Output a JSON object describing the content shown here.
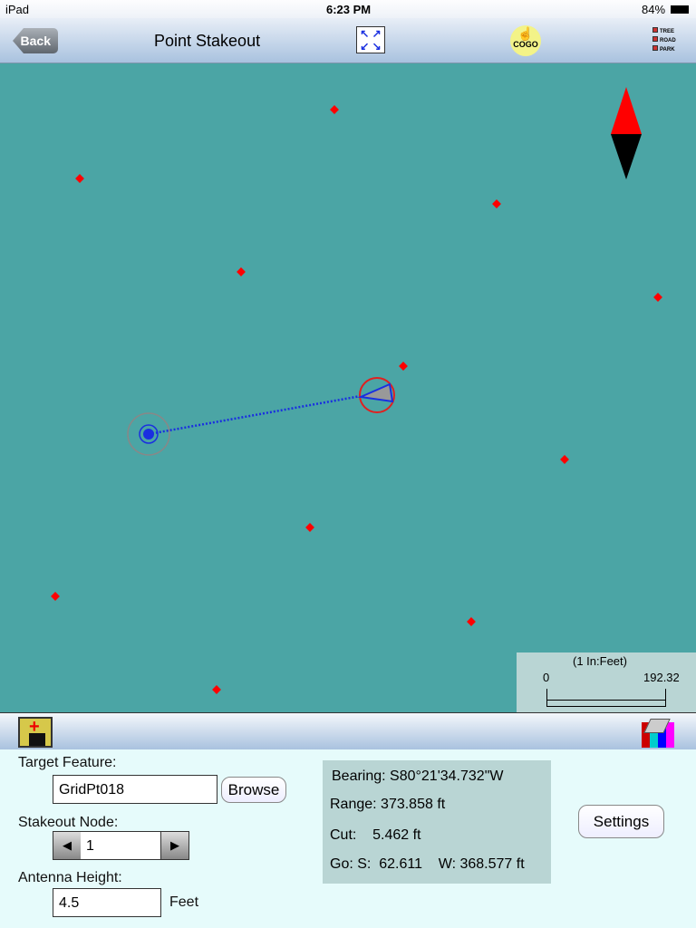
{
  "status": {
    "device": "iPad",
    "time": "6:23 PM",
    "battery": "84%"
  },
  "nav": {
    "back": "Back",
    "title": "Point Stakeout",
    "cogo": "COGO",
    "legend": [
      "TREE",
      "ROAD",
      "PARK"
    ]
  },
  "scale": {
    "title": "(1 In:Feet)",
    "min": "0",
    "max": "192.32"
  },
  "colors": {
    "map_bg": "#4ba5a5",
    "point": "#ff0000",
    "track": "#1a2fe0"
  },
  "panel": {
    "target_label": "Target Feature:",
    "target_value": "GridPt018",
    "browse": "Browse",
    "node_label": "Stakeout Node:",
    "node_value": "1",
    "antenna_label": "Antenna Height:",
    "antenna_value": "4.5",
    "antenna_unit": "Feet",
    "bearing": "Bearing: S80°21'34.732\"W",
    "range": "Range:  373.858 ft",
    "cut": "Cut:    5.462 ft",
    "go": "Go: S:  62.611    W: 368.577 ft",
    "settings": "Settings"
  }
}
